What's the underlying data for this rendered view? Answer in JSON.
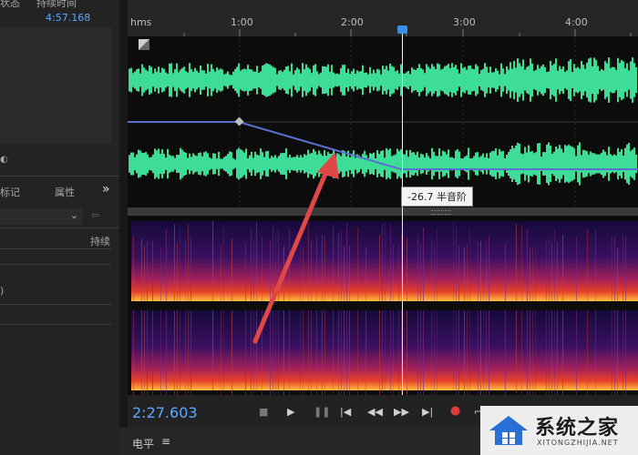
{
  "left_panel": {
    "header_status": "状态",
    "header_duration": "持续时间",
    "duration_value": "4:57.168",
    "tab_markers": "标记",
    "tab_properties": "属性",
    "expand_symbol": "»",
    "duration_label": "持续",
    "paren_char": ")"
  },
  "ruler": {
    "format_label": "hms",
    "ticks": [
      "1:00",
      "2:00",
      "3:00",
      "4:00"
    ]
  },
  "tooltip": {
    "pitch_value": "-26.7 半音阶"
  },
  "transport": {
    "current_time": "2:27.603"
  },
  "bottom_bar": {
    "level_label": "电平",
    "menu_symbol": "≡"
  },
  "watermark": {
    "brand_name": "系统之家",
    "brand_url": "XITONGZHIJIA.NET"
  },
  "colors": {
    "waveform": "#3ddc97",
    "envelope": "#5a6fd0",
    "time_blue": "#5aa9ff",
    "record_red": "#e23b3b",
    "arrow_red": "#e04848"
  }
}
